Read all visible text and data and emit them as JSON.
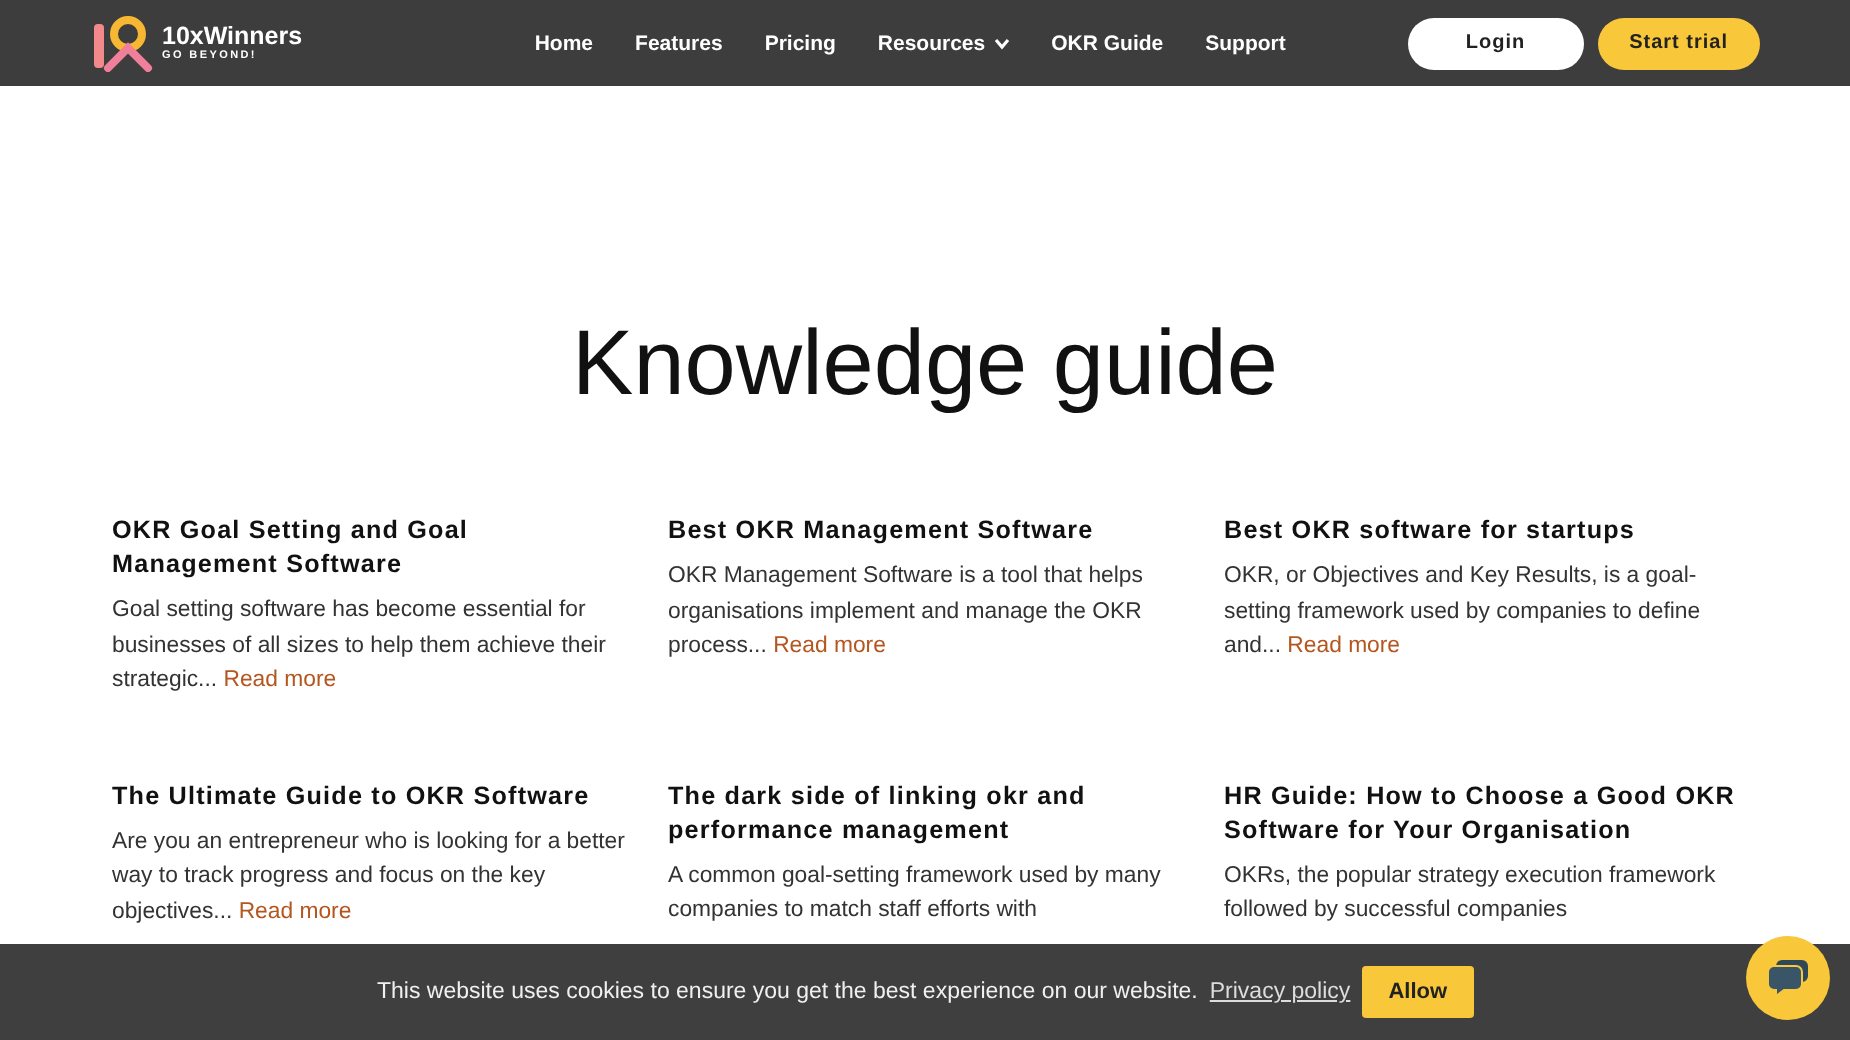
{
  "header": {
    "logo": {
      "name": "10xWinners",
      "tagline": "GO BEYOND!"
    },
    "nav": [
      {
        "label": "Home",
        "dropdown": false
      },
      {
        "label": "Features",
        "dropdown": false
      },
      {
        "label": "Pricing",
        "dropdown": false
      },
      {
        "label": "Resources",
        "dropdown": true
      },
      {
        "label": "OKR Guide",
        "dropdown": false
      },
      {
        "label": "Support",
        "dropdown": false
      }
    ],
    "login": "Login",
    "start_trial": "Start trial"
  },
  "title": "Knowledge guide",
  "articles": [
    {
      "title": "OKR Goal Setting and Goal Management Software",
      "excerpt": "Goal setting software has become essential for businesses of all sizes to help them achieve their strategic...",
      "link": "Read more"
    },
    {
      "title": "Best OKR Management Software",
      "excerpt": "OKR Management Software is a tool that helps organisations implement and manage the OKR process...",
      "link": "Read more"
    },
    {
      "title": "Best OKR software for startups",
      "excerpt": "OKR, or Objectives and Key Results, is a goal-setting framework used by companies to define and...",
      "link": "Read more"
    },
    {
      "title": "The Ultimate Guide to OKR Software",
      "excerpt": "Are you an entrepreneur who is looking for a better way to track progress and focus on the key objectives...",
      "link": "Read more"
    },
    {
      "title": "The dark side of linking okr and performance management",
      "excerpt": "A common goal-setting framework used by many companies to match staff efforts with"
    },
    {
      "title": "HR Guide: How to Choose a Good OKR Software for Your Organisation",
      "excerpt": "OKRs, the popular strategy execution framework followed by successful companies"
    }
  ],
  "cookie_bar": {
    "message": "This website uses cookies to ensure you get the best experience on our website.",
    "policy_link": "Privacy policy",
    "allow": "Allow"
  }
}
